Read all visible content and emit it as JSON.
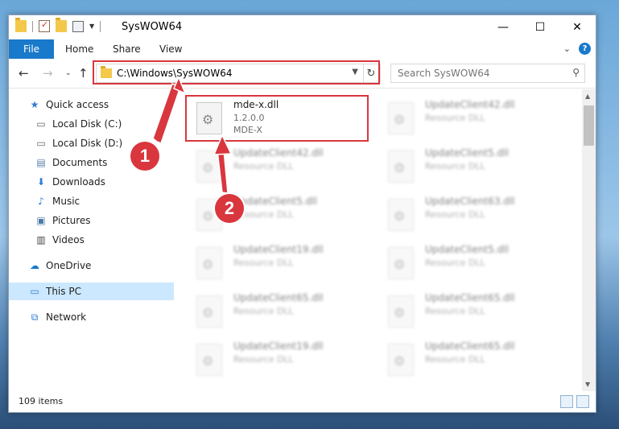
{
  "window": {
    "title": "SysWOW64"
  },
  "ribbon": {
    "tabs": [
      "File",
      "Home",
      "Share",
      "View"
    ]
  },
  "address": {
    "path": "C:\\Windows\\SysWOW64"
  },
  "search": {
    "placeholder": "Search SysWOW64"
  },
  "sidebar": {
    "items": [
      {
        "label": "Quick access",
        "icon": "star-icon"
      },
      {
        "label": "Local Disk (C:)",
        "icon": "drive-icon"
      },
      {
        "label": "Local Disk (D:)",
        "icon": "drive-icon"
      },
      {
        "label": "Documents",
        "icon": "documents-icon"
      },
      {
        "label": "Downloads",
        "icon": "download-icon"
      },
      {
        "label": "Music",
        "icon": "music-icon"
      },
      {
        "label": "Pictures",
        "icon": "pictures-icon"
      },
      {
        "label": "Videos",
        "icon": "videos-icon"
      },
      {
        "label": "OneDrive",
        "icon": "cloud-icon"
      },
      {
        "label": "This PC",
        "icon": "computer-icon"
      },
      {
        "label": "Network",
        "icon": "network-icon"
      }
    ]
  },
  "files": {
    "highlighted": {
      "name": "mde-x.dll",
      "version": "1.2.0.0",
      "description": "MDE-X"
    },
    "col1": [
      {
        "name": "UpdateClient42.dll",
        "type": "Resource DLL"
      },
      {
        "name": "UpdateClient5.dll",
        "type": "Resource DLL"
      },
      {
        "name": "UpdateClient19.dll",
        "type": "Resource DLL"
      },
      {
        "name": "UpdateClient65.dll",
        "type": "Resource DLL"
      },
      {
        "name": "UpdateClient19.dll",
        "type": "Resource DLL"
      }
    ],
    "col2": [
      {
        "name": "UpdateClient42.dll",
        "type": "Resource DLL"
      },
      {
        "name": "UpdateClient5.dll",
        "type": "Resource DLL"
      },
      {
        "name": "UpdateClient63.dll",
        "type": "Resource DLL"
      },
      {
        "name": "UpdateClient5.dll",
        "type": "Resource DLL"
      },
      {
        "name": "UpdateClient65.dll",
        "type": "Resource DLL"
      },
      {
        "name": "UpdateClient65.dll",
        "type": "Resource DLL"
      }
    ]
  },
  "status": {
    "count": "109 items"
  },
  "annotations": {
    "step1": "1",
    "step2": "2",
    "color": "#d9363e"
  }
}
